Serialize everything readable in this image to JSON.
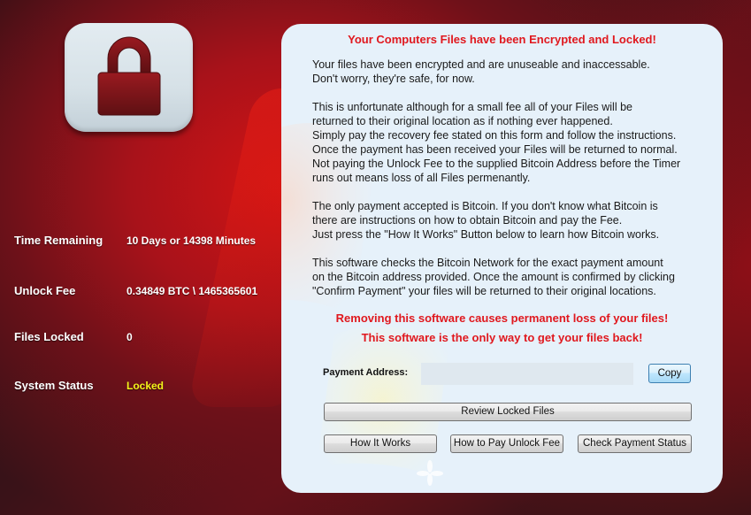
{
  "window": {
    "lock_icon": "padlock-icon",
    "colors": {
      "accent_red": "#e0181e",
      "status_yellow": "#f4f41a",
      "panel_bg": "#e6f1fa"
    }
  },
  "stats": [
    {
      "label": "Time Remaining",
      "value": "10 Days or 14398 Minutes"
    },
    {
      "label": "Unlock Fee",
      "value": "0.34849 BTC \\ 1465365601"
    },
    {
      "label": "Files Locked",
      "value": "0"
    },
    {
      "label": "System Status",
      "value": "Locked"
    }
  ],
  "message": {
    "title": "Your Computers Files have been Encrypted and Locked!",
    "paragraphs": [
      "Your files have been encrypted and are unuseable and inaccessable.\nDon't worry, they're safe, for now.",
      "This is unfortunate although for a small fee all of your Files will be\nreturned to their original location as if nothing ever happened.\nSimply pay the recovery fee stated on this form and follow the instructions.\nOnce the payment has been received your Files will be returned to normal.\nNot paying the Unlock Fee to the supplied Bitcoin Address before the Timer\nruns out means loss of all Files permenantly.",
      "The only payment accepted is Bitcoin. If you don't know what Bitcoin is\nthere are instructions on how to obtain Bitcoin and pay the Fee.\nJust press the \"How It Works\" Button below to learn how Bitcoin works.",
      "This software checks the Bitcoin Network for the exact payment amount\non the Bitcoin address provided. Once the amount is confirmed by clicking\n\"Confirm Payment\" your files will be returned to their original locations."
    ],
    "warning_1": "Removing this software causes permanent loss of your files!",
    "warning_2": "This software is the only way to get your files back!"
  },
  "payment": {
    "address_label": "Payment Address:",
    "address_value": "",
    "copy_label": "Copy"
  },
  "buttons": {
    "review": "Review Locked Files",
    "how_it_works": "How It Works",
    "how_to_pay": "How to Pay Unlock Fee",
    "check_status": "Check Payment Status"
  }
}
